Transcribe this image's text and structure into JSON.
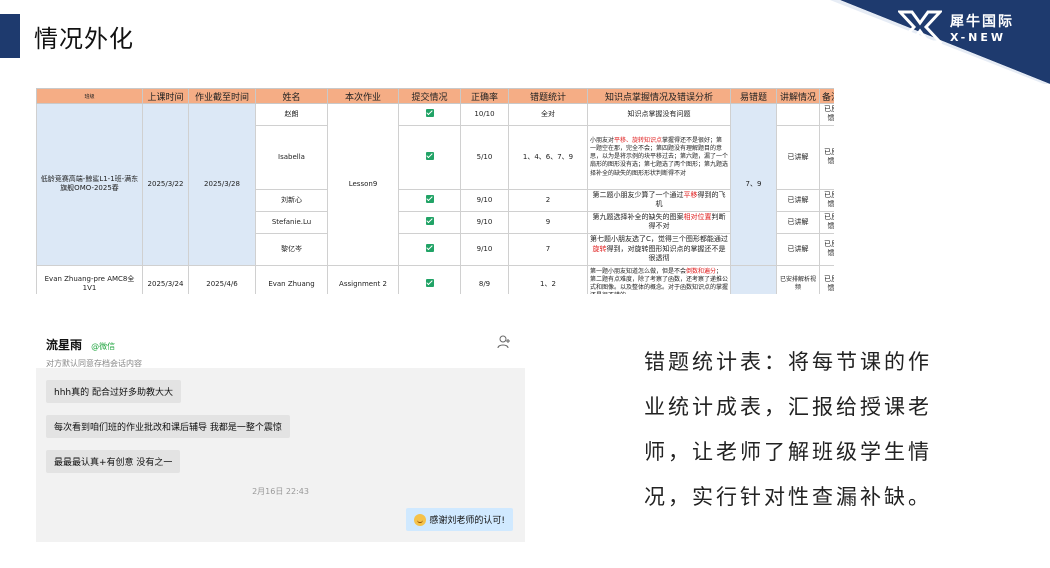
{
  "slide": {
    "title": "情况外化"
  },
  "logo": {
    "cn": "犀牛国际",
    "en": "X-NEW"
  },
  "colors": {
    "accent": "#1e3a6e",
    "header": "#f5ad85",
    "cell_blue": "#dce8f6",
    "check": "#21a366",
    "highlight": "#e02020"
  },
  "table": {
    "headers": [
      "班级",
      "上课时间",
      "作业截至时间",
      "姓名",
      "本次作业",
      "提交情况",
      "正确率",
      "错题统计",
      "知识点掌握情况及错误分析",
      "易错题",
      "讲解情况",
      "备注"
    ],
    "group1": {
      "class": "低龄竞赛高端-鲸鲨L1-1班-满东旗舰OMO-2025春",
      "date": "2025/3/22",
      "deadline": "2025/3/28",
      "homework": "Lesson9",
      "hard": "7、9",
      "rows": [
        {
          "name": "赵朗",
          "rate": "10/10",
          "errors": "全对",
          "analysis_pre": "知识点掌握没有问题",
          "analysis_red": "",
          "analysis_post": "",
          "explain": "",
          "note": "已反馈"
        },
        {
          "name": "Isabella",
          "rate": "5/10",
          "errors": "1、4、6、7、9",
          "analysis_pre": "小朋友对",
          "analysis_red": "平移、旋转知识点",
          "analysis_post": "掌握得还不是很好；第一题空在那，完全不会；第四题没有理解题目的意思，以为是将示例的块平移过去；第六题，漏了一个扇形的图形没有选；第七题选了两个图形；第九题选择补全的缺失的图形形状判断得不对",
          "explain": "已讲解",
          "note": "已反馈"
        },
        {
          "name": "刘新心",
          "rate": "9/10",
          "errors": "2",
          "analysis_pre": "第二题小朋友少算了一个通过",
          "analysis_red": "平移",
          "analysis_post": "得到的飞机",
          "explain": "已讲解",
          "note": "已反馈"
        },
        {
          "name": "Stefanie.Lu",
          "rate": "9/10",
          "errors": "9",
          "analysis_pre": "第九题选择补全的缺失的图案",
          "analysis_red": "相对位置",
          "analysis_post": "判断得不对",
          "explain": "已讲解",
          "note": "已反馈"
        },
        {
          "name": "黎亿岑",
          "rate": "9/10",
          "errors": "7",
          "analysis_pre": "第七题小朋友选了C，觉得三个图形都能通过",
          "analysis_red": "旋转",
          "analysis_post": "得到，对旋转图形知识点的掌握还不是很透彻",
          "explain": "已讲解",
          "note": "已反馈"
        }
      ]
    },
    "group2": {
      "class": "Evan Zhuang-pre AMC8全1V1",
      "date": "2025/3/24",
      "deadline": "2025/4/6",
      "name": "Evan Zhuang",
      "homework": "Assignment 2",
      "rate": "8/9",
      "errors": "1、2",
      "analysis_pre": "第一题小朋友知道怎么做，但是不会",
      "analysis_red": "倒数和遍分",
      "analysis_post": "；第二题有点难度，除了考察了函数，还考察了递推公式和图像。以及整体的概念。对于函数知识点的掌握还是很不错的",
      "explain": "已安排解析视频",
      "note": "已反馈"
    }
  },
  "chat": {
    "name": "流星雨",
    "tag": "@微信",
    "subtitle": "对方默认同意存档会话内容",
    "messages": [
      "hhh真的 配合过好多助教大大",
      "每次看到咱们班的作业批改和课后辅导 我都是一整个震惊",
      "最最最认真+有创意  没有之一"
    ],
    "timestamp": "2月16日 22:43",
    "reply": "感谢刘老师的认可!"
  },
  "note": {
    "lines": [
      "错题统计表：将每节课的作",
      "业统计成表，汇报给授课老",
      "师，让老师了解班级学生情",
      "况，实行针对性查漏补缺。"
    ]
  }
}
